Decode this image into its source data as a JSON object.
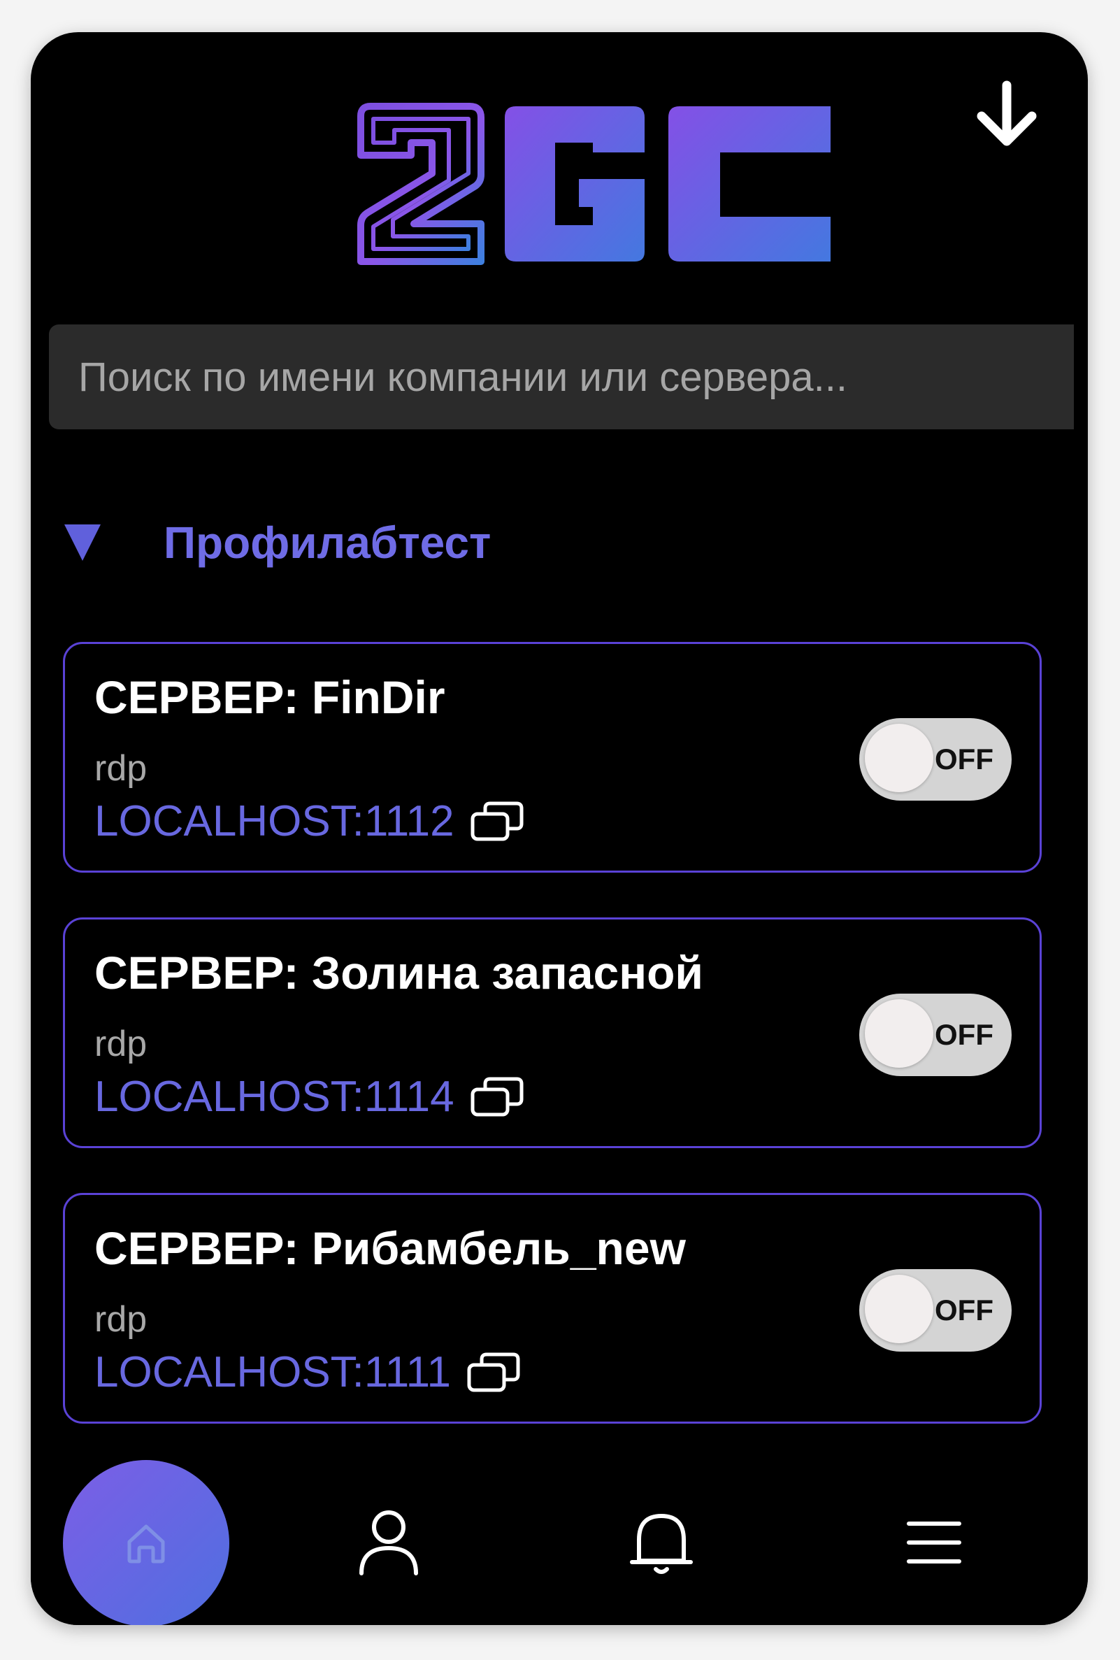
{
  "header": {
    "logo_text": "2GC",
    "download_icon": "arrow-down-icon"
  },
  "search": {
    "placeholder": "Поиск по имени компании или сервера..."
  },
  "group": {
    "title": "Профилабтест",
    "expanded": true,
    "icon": "caret-down-icon"
  },
  "servers": [
    {
      "title": "СЕРВЕР: FinDir",
      "protocol": "rdp",
      "host": "LOCALHOST:1112",
      "toggle": "OFF"
    },
    {
      "title": "СЕРВЕР: Золина запасной",
      "protocol": "rdp",
      "host": "LOCALHOST:1114",
      "toggle": "OFF"
    },
    {
      "title": "СЕРВЕР: Рибамбель_new",
      "protocol": "rdp",
      "host": "LOCALHOST:1111",
      "toggle": "OFF"
    }
  ],
  "nav": {
    "items": [
      {
        "name": "home",
        "icon": "home-icon",
        "active": true
      },
      {
        "name": "profile",
        "icon": "user-icon",
        "active": false
      },
      {
        "name": "notifications",
        "icon": "bell-icon",
        "active": false
      },
      {
        "name": "menu",
        "icon": "menu-icon",
        "active": false
      }
    ]
  },
  "colors": {
    "background": "#000000",
    "accent": "#6868e0",
    "card_border": "#5a42d6",
    "search_bg": "#2b2b2b",
    "toggle_off": "#d4d4d4"
  }
}
